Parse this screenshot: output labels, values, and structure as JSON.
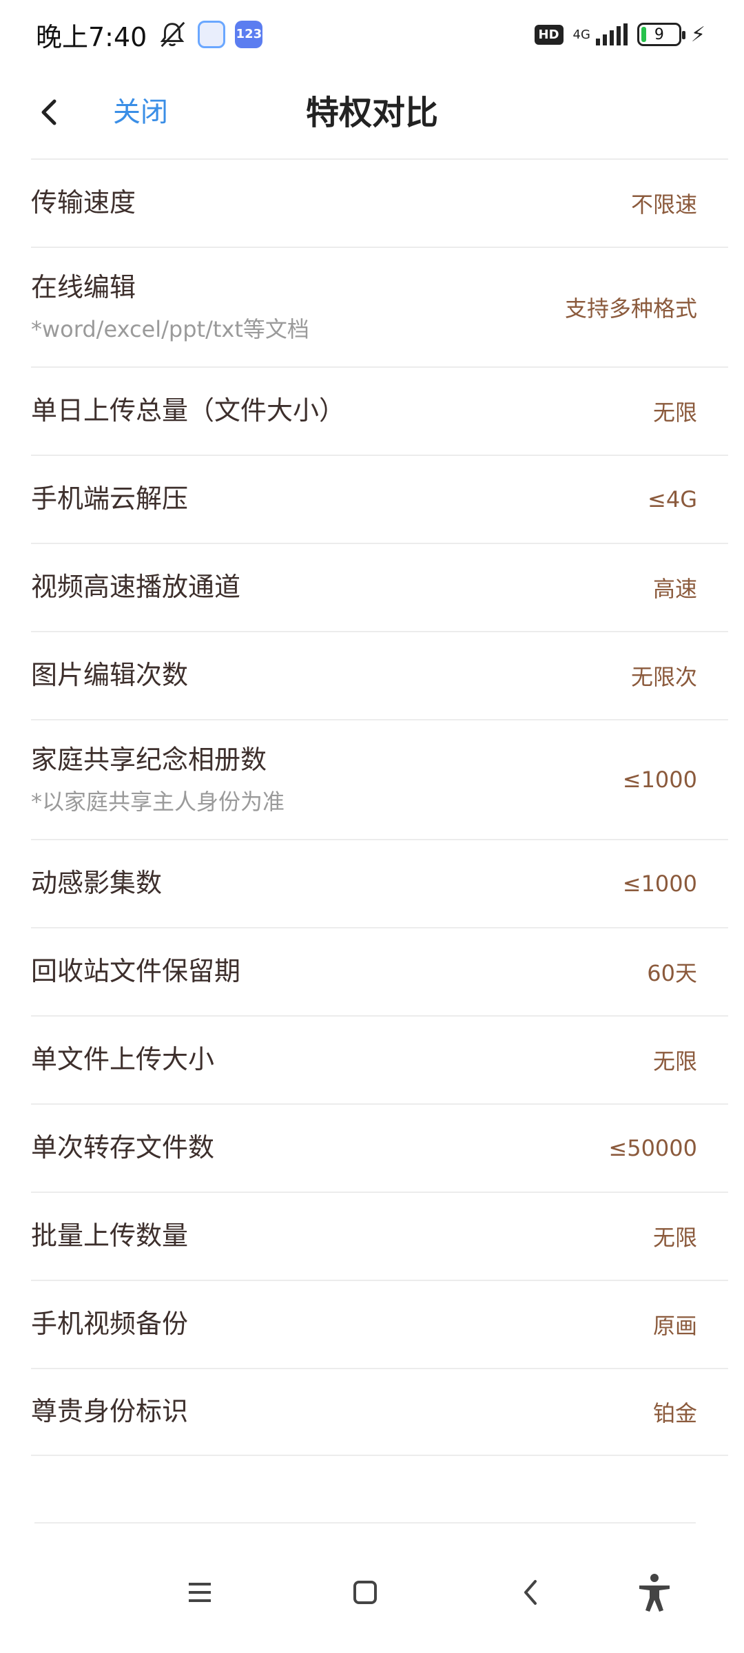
{
  "status_bar": {
    "time": "晚上7:40",
    "hd": "HD",
    "network": "4G",
    "battery": "9"
  },
  "header": {
    "close_label": "关闭",
    "title": "特权对比"
  },
  "rows": [
    {
      "label": "传输速度",
      "note": "",
      "value": "不限速"
    },
    {
      "label": "在线编辑",
      "note": "*word/excel/ppt/txt等文档",
      "value": "支持多种格式"
    },
    {
      "label": "单日上传总量（文件大小）",
      "note": "",
      "value": "无限"
    },
    {
      "label": "手机端云解压",
      "note": "",
      "value": "≤4G"
    },
    {
      "label": "视频高速播放通道",
      "note": "",
      "value": "高速"
    },
    {
      "label": "图片编辑次数",
      "note": "",
      "value": "无限次"
    },
    {
      "label": "家庭共享纪念相册数",
      "note": "*以家庭共享主人身份为准",
      "value": "≤1000"
    },
    {
      "label": "动感影集数",
      "note": "",
      "value": "≤1000"
    },
    {
      "label": "回收站文件保留期",
      "note": "",
      "value": "60天"
    },
    {
      "label": "单文件上传大小",
      "note": "",
      "value": "无限"
    },
    {
      "label": "单次转存文件数",
      "note": "",
      "value": "≤50000"
    },
    {
      "label": "批量上传数量",
      "note": "",
      "value": "无限"
    },
    {
      "label": "手机视频备份",
      "note": "",
      "value": "原画"
    },
    {
      "label": "尊贵身份标识",
      "note": "",
      "value": "铂金"
    }
  ],
  "colors": {
    "accent": "#3a8ee6",
    "value": "#8b5a3c",
    "label": "#3d2f2c",
    "note": "#9a9a9a"
  },
  "icons": {
    "back": "chevron-left-icon",
    "nav_menu": "menu-icon",
    "nav_home": "home-square-icon",
    "nav_back": "back-chevron-icon",
    "nav_accessibility": "accessibility-icon"
  }
}
